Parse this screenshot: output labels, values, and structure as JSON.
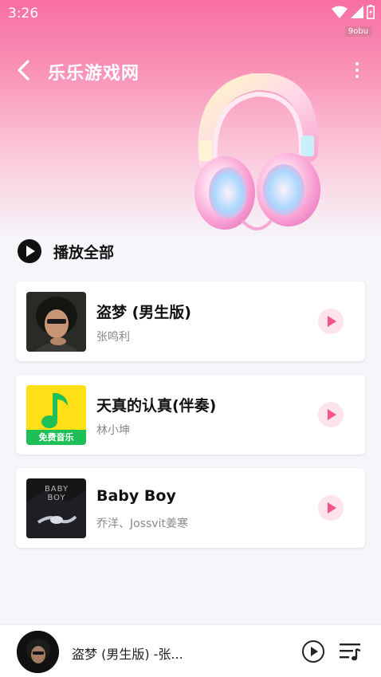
{
  "status_bar": {
    "time": "3:26",
    "watermark": "9obu"
  },
  "header": {
    "title": "乐乐游戏网",
    "back_icon": "back-arrow-icon",
    "more_icon": "more-vert-icon"
  },
  "play_all": {
    "label": "播放全部"
  },
  "songs": [
    {
      "title": "盗梦 (男生版)",
      "artist": "张鸣利"
    },
    {
      "title": "天真的认真(伴奏)",
      "artist": "林小坤",
      "cover_text": "免费音乐"
    },
    {
      "title": "Baby Boy",
      "artist": " 乔洋、Jossvit姜寒",
      "cover_text": "BABY BOY"
    }
  ],
  "player": {
    "now_playing": "盗梦 (男生版) -张..."
  },
  "colors": {
    "accent": "#f4548a",
    "accent_light": "#fde3ec",
    "gradient_top": "#f76fa0"
  }
}
